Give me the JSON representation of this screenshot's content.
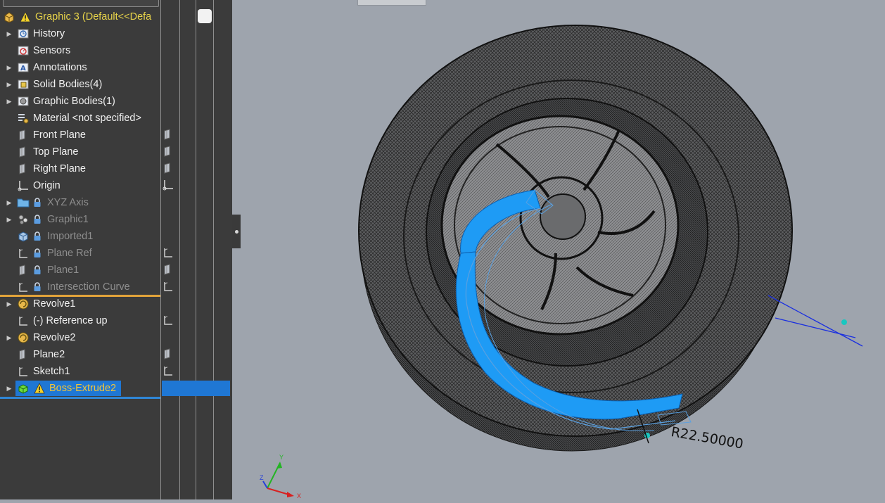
{
  "tree": {
    "root": {
      "label": "Graphic 3  (Default<<Defa",
      "warning": true
    },
    "items": [
      {
        "label": "History",
        "icon": "history-icon",
        "expand": true,
        "state": "normal"
      },
      {
        "label": "Sensors",
        "icon": "sensors-icon",
        "expand": false,
        "state": "normal"
      },
      {
        "label": "Annotations",
        "icon": "annotations-icon",
        "expand": true,
        "state": "normal"
      },
      {
        "label": "Solid Bodies(4)",
        "icon": "solid-bodies-icon",
        "expand": true,
        "state": "normal"
      },
      {
        "label": "Graphic Bodies(1)",
        "icon": "graphic-bodies-icon",
        "expand": true,
        "state": "normal"
      },
      {
        "label": "Material <not specified>",
        "icon": "material-icon",
        "expand": false,
        "state": "normal"
      },
      {
        "label": "Front Plane",
        "icon": "plane-icon",
        "expand": false,
        "state": "normal"
      },
      {
        "label": "Top Plane",
        "icon": "plane-icon",
        "expand": false,
        "state": "normal"
      },
      {
        "label": "Right Plane",
        "icon": "plane-icon",
        "expand": false,
        "state": "normal"
      },
      {
        "label": "Origin",
        "icon": "origin-icon",
        "expand": false,
        "state": "normal"
      },
      {
        "label": "XYZ Axis",
        "icon": "folder-icon",
        "expand": true,
        "state": "locked"
      },
      {
        "label": "Graphic1",
        "icon": "graphic-icon",
        "expand": true,
        "state": "locked"
      },
      {
        "label": "Imported1",
        "icon": "imported-icon",
        "expand": false,
        "state": "locked"
      },
      {
        "label": "Plane Ref",
        "icon": "sketch-icon",
        "expand": false,
        "state": "locked"
      },
      {
        "label": "Plane1",
        "icon": "plane-icon",
        "expand": false,
        "state": "locked"
      },
      {
        "label": "Intersection Curve",
        "icon": "sketch-icon",
        "expand": false,
        "state": "locked"
      },
      {
        "label": "Revolve1",
        "icon": "revolve-icon",
        "expand": true,
        "state": "normal"
      },
      {
        "label": "(-) Reference up",
        "icon": "sketch-icon",
        "expand": false,
        "state": "normal"
      },
      {
        "label": "Revolve2",
        "icon": "revolve-icon",
        "expand": true,
        "state": "normal"
      },
      {
        "label": "Plane2",
        "icon": "plane-icon",
        "expand": false,
        "state": "normal"
      },
      {
        "label": "Sketch1",
        "icon": "sketch-icon",
        "expand": false,
        "state": "normal"
      },
      {
        "label": "Boss-Extrude2",
        "icon": "boss-extrude-icon",
        "expand": true,
        "state": "selected",
        "warning": true
      }
    ]
  },
  "viewport": {
    "dimension": "R22.50000",
    "triad_labels": {
      "x": "X",
      "y": "Y",
      "z": "Z"
    }
  },
  "colors": {
    "panel": "#3b3b3b",
    "viewport": "#9ea4ad",
    "selection": "#1f77d4",
    "extrude": "#1e9bf5",
    "rollback": "#e2a33a"
  }
}
